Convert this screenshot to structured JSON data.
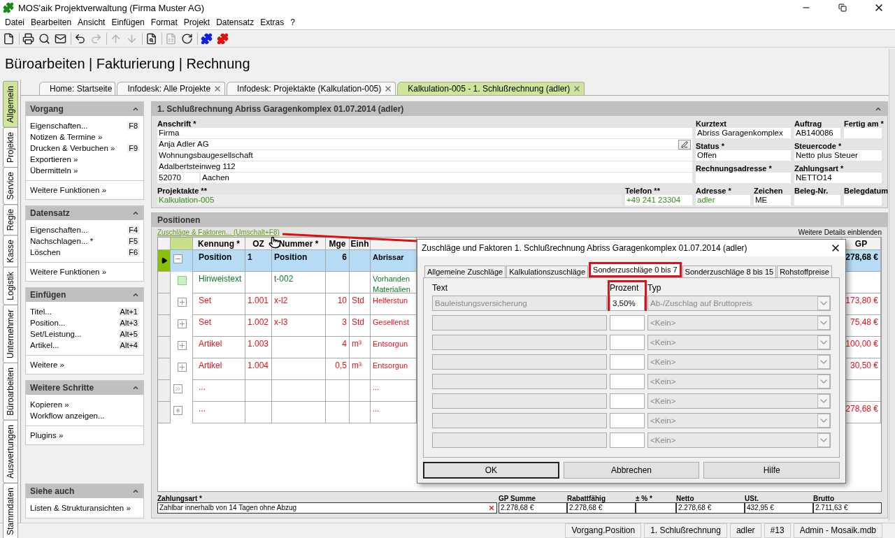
{
  "window": {
    "title": "MOS'aik Projektverwaltung (Firma Muster AG)"
  },
  "menu": [
    "Datei",
    "Bearbeiten",
    "Ansicht",
    "Einfügen",
    "Format",
    "Projekt",
    "Datensatz",
    "Extras",
    "?"
  ],
  "toolbar": [
    [
      {
        "kind": "new",
        "disabled": false
      }
    ],
    [
      {
        "kind": "print",
        "disabled": false
      },
      {
        "kind": "preview",
        "disabled": false
      },
      {
        "kind": "mail",
        "disabled": false
      }
    ],
    [
      {
        "kind": "undo",
        "disabled": false
      },
      {
        "kind": "redo",
        "disabled": true
      }
    ],
    [
      {
        "kind": "up",
        "disabled": true
      },
      {
        "kind": "down",
        "disabled": true
      }
    ],
    [
      {
        "kind": "find",
        "disabled": false
      }
    ],
    [
      {
        "kind": "excel",
        "disabled": true
      },
      {
        "kind": "refresh",
        "disabled": false
      }
    ],
    [
      {
        "kind": "plugin",
        "disabled": false,
        "color": "#1020e0"
      },
      {
        "kind": "plugin",
        "disabled": false,
        "color": "#e01010"
      }
    ]
  ],
  "heading": "Büroarbeiten | Fakturierung | Rechnung",
  "side_tabs": [
    {
      "label": "Allgemein",
      "selected": true
    },
    {
      "label": "Projekte",
      "selected": false
    },
    {
      "label": "Service",
      "selected": false
    },
    {
      "label": "Regie",
      "selected": false
    },
    {
      "label": "Kasse",
      "selected": false
    },
    {
      "label": "Logistik",
      "selected": false
    },
    {
      "label": "Unternehmer",
      "selected": false
    },
    {
      "label": "Büroarbeiten",
      "selected": false
    },
    {
      "label": "Auswertungen",
      "selected": false
    },
    {
      "label": "Stammdaten",
      "selected": false
    }
  ],
  "doc_tabs": [
    {
      "label": "Home: Startseite",
      "closable": false,
      "selected": false
    },
    {
      "label": "Infodesk: Alle Projekte",
      "closable": true,
      "selected": false
    },
    {
      "label": "Infodesk: Projektakte (Kalkulation-005)",
      "closable": true,
      "selected": false
    },
    {
      "label": "Kalkulation-005 - 1. Schlußrechnung (adler)",
      "closable": true,
      "selected": true
    }
  ],
  "task_panel": [
    {
      "title": "Vorgang",
      "items": [
        {
          "label": "Eigenschaften...",
          "shortcut": "F8"
        },
        {
          "label": "Notizen & Termine »"
        },
        {
          "label": "Drucken & Verbuchen »",
          "shortcut": "F9"
        },
        {
          "label": "Exportieren »"
        },
        {
          "label": "Übermitteln »"
        }
      ],
      "footer": [
        "Weitere Funktionen »"
      ]
    },
    {
      "title": "Datensatz",
      "items": [
        {
          "label": "Eigenschaften...",
          "shortcut": "F4"
        },
        {
          "label": "Nachschlagen... *",
          "shortcut": "F5"
        },
        {
          "label": "Löschen",
          "shortcut": "F6"
        }
      ],
      "footer": [
        "Weitere Funktionen »"
      ]
    },
    {
      "title": "Einfügen",
      "items": [
        {
          "label": "Titel...",
          "shortcut": "Alt+1"
        },
        {
          "label": "Position...",
          "shortcut": "Alt+3"
        },
        {
          "label": "Set/Leistung...",
          "shortcut": "Alt+5"
        },
        {
          "label": "Artikel...",
          "shortcut": "Alt+4"
        }
      ],
      "footer": [
        "Weitere »"
      ]
    },
    {
      "title": "Weitere Schritte",
      "items": [
        {
          "label": "Kopieren »"
        },
        {
          "label": "Workflow anzeigen..."
        }
      ],
      "footer": [
        "Plugins »"
      ]
    },
    {
      "title": "Siehe auch",
      "items": [
        {
          "label": "Listen & Strukturansichten »"
        }
      ],
      "pinned_bottom": true
    }
  ],
  "document": {
    "title": "1. Schlußrechnung Abriss Garagenkomplex 01.07.2014 (adler)",
    "address": {
      "label": "Anschrift *",
      "lines": [
        "Firma",
        "Anja Adler AG",
        "Wohnungsbaugesellschaft",
        "Adalbertsteinweg 112"
      ],
      "zip": "52070",
      "city": "Aachen"
    },
    "fields": [
      {
        "label": "Kurztext",
        "value": "Abriss Garagenkomplex"
      },
      {
        "label": "Auftrag",
        "value": "AB140086"
      },
      {
        "label": "Fertig am *"
      },
      {
        "label": "Status *",
        "value": "Offen"
      },
      {
        "label": "Steuercode *",
        "value": "Netto plus Steuer"
      },
      {
        "label": "Rechnungsadresse *"
      },
      {
        "label": "Zahlungsart *",
        "value": "NETTO14"
      },
      {
        "label": "Projektakte **",
        "value": "Kalkulation-005",
        "linked": true
      },
      {
        "label": "Telefon **",
        "value": "+49 241 23304",
        "linked": true
      },
      {
        "label": "Adresse *",
        "value": "adler",
        "linked": true
      },
      {
        "label": "Zeichen",
        "value": "ME"
      },
      {
        "label": "Beleg-Nr."
      },
      {
        "label": "Belegdatum"
      }
    ]
  },
  "positions": {
    "title": "Positionen",
    "link": "Zuschläge & Faktoren... (Umschalt+F8)",
    "details_link": "Weitere Details einblenden",
    "columns": [
      "Kennung *",
      "OZ",
      "Nummer *",
      "Mge",
      "Einh",
      "GP"
    ],
    "rows": [
      {
        "kind": "position",
        "selected": true,
        "expanded": true,
        "kennung": "Position",
        "oz": "1",
        "nummer": "Position",
        "mge": "6",
        "text": [
          "Abrissar"
        ],
        "gp": "278,68 €"
      },
      {
        "kind": "note",
        "selected": false,
        "kennung": "Hinweistext",
        "nummer": "t-002",
        "text": [
          "Vorhanden",
          "Materialien"
        ]
      },
      {
        "kind": "set",
        "selected": false,
        "expanded": false,
        "kennung": "Set",
        "oz": "1.001",
        "nummer": "x-l2",
        "mge": "10",
        "einh": "Std",
        "text": [
          "Helferstun"
        ],
        "gp": "173,80 €"
      },
      {
        "kind": "set",
        "selected": false,
        "expanded": false,
        "kennung": "Set",
        "oz": "1.002",
        "nummer": "x-l3",
        "mge": "3",
        "einh": "Std",
        "text": [
          "Gesellenst"
        ],
        "gp": "75,48 €"
      },
      {
        "kind": "article",
        "selected": false,
        "expanded": false,
        "kennung": "Artikel",
        "oz": "1.003",
        "mge": "4",
        "einh": "m³",
        "text": [
          "Entsorgun"
        ],
        "gp": "100,00 €"
      },
      {
        "kind": "article",
        "selected": false,
        "expanded": false,
        "kennung": "Artikel",
        "oz": "1.004",
        "mge": "0,5",
        "einh": "m³",
        "text": [
          "Entsorgun"
        ],
        "gp": "30,50 €"
      },
      {
        "kind": "append",
        "selected": false,
        "kennung": "...",
        "text": [
          "..."
        ]
      },
      {
        "kind": "new",
        "selected": false,
        "kennung": "...",
        "text": [
          "..."
        ],
        "gp": "278,68 €"
      }
    ],
    "payment": {
      "label": "Zahlungsart *",
      "value": "Zahlbar innerhalb von 14 Tagen ohne Abzug"
    },
    "totals": [
      {
        "label": "GP Summe",
        "value": "2.278,68 €"
      },
      {
        "label": "Rabattfähig",
        "value": "2.278,68 €"
      },
      {
        "label": "± % *"
      },
      {
        "label": "Netto",
        "value": "2.278,68 €"
      },
      {
        "label": "USt.",
        "value": "432,95 €"
      },
      {
        "label": "Brutto",
        "value": "2.711,63 €"
      }
    ]
  },
  "dialog": {
    "title": "Zuschläge und Faktoren 1. Schlußrechnung Abriss Garagenkomplex 01.07.2014 (adler)",
    "tabs": [
      {
        "label": "Allgemeine Zuschläge",
        "selected": false,
        "marked": false
      },
      {
        "label": "Kalkulationszuschläge",
        "selected": false,
        "marked": false
      },
      {
        "label": "Sonderzuschläge 0 bis 7",
        "selected": true,
        "marked": true
      },
      {
        "label": "Sonderzuschläge 8 bis 15",
        "selected": false,
        "marked": false
      },
      {
        "label": "Rohstoffpreise",
        "selected": false,
        "marked": false
      }
    ],
    "columns": [
      "Text",
      "Prozent",
      "Typ"
    ],
    "percent_marked": true,
    "rows": [
      {
        "text": "Bauleistungsversicherung",
        "percent": "3,50%",
        "type": "Ab-/Zuschlag auf Bruttopreis"
      },
      {
        "type": "<Kein>"
      },
      {
        "type": "<Kein>"
      },
      {
        "type": "<Kein>"
      },
      {
        "type": "<Kein>"
      },
      {
        "type": "<Kein>"
      },
      {
        "type": "<Kein>"
      },
      {
        "type": "<Kein>"
      }
    ],
    "buttons": [
      {
        "label": "OK",
        "default": true
      },
      {
        "label": "Abbrechen",
        "default": false
      },
      {
        "label": "Hilfe",
        "default": false
      }
    ]
  },
  "status_bar": [
    "Vorgang.Position",
    "1. Schlußrechnung",
    "adler",
    "#13",
    "Admin - Mosaik.mdb"
  ]
}
